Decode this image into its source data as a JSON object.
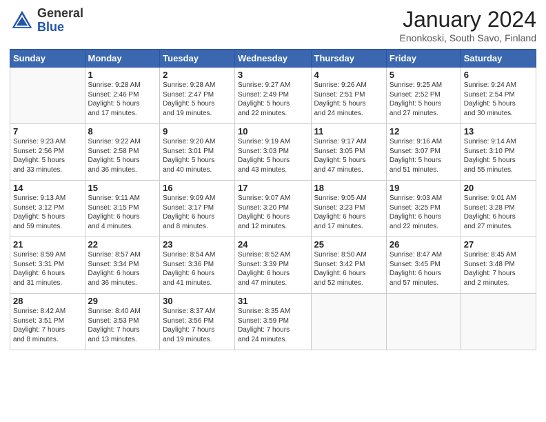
{
  "logo": {
    "general": "General",
    "blue": "Blue"
  },
  "header": {
    "month": "January 2024",
    "location": "Enonkoski, South Savo, Finland"
  },
  "weekdays": [
    "Sunday",
    "Monday",
    "Tuesday",
    "Wednesday",
    "Thursday",
    "Friday",
    "Saturday"
  ],
  "weeks": [
    [
      {
        "day": "",
        "info": ""
      },
      {
        "day": "1",
        "info": "Sunrise: 9:28 AM\nSunset: 2:46 PM\nDaylight: 5 hours\nand 17 minutes."
      },
      {
        "day": "2",
        "info": "Sunrise: 9:28 AM\nSunset: 2:47 PM\nDaylight: 5 hours\nand 19 minutes."
      },
      {
        "day": "3",
        "info": "Sunrise: 9:27 AM\nSunset: 2:49 PM\nDaylight: 5 hours\nand 22 minutes."
      },
      {
        "day": "4",
        "info": "Sunrise: 9:26 AM\nSunset: 2:51 PM\nDaylight: 5 hours\nand 24 minutes."
      },
      {
        "day": "5",
        "info": "Sunrise: 9:25 AM\nSunset: 2:52 PM\nDaylight: 5 hours\nand 27 minutes."
      },
      {
        "day": "6",
        "info": "Sunrise: 9:24 AM\nSunset: 2:54 PM\nDaylight: 5 hours\nand 30 minutes."
      }
    ],
    [
      {
        "day": "7",
        "info": "Sunrise: 9:23 AM\nSunset: 2:56 PM\nDaylight: 5 hours\nand 33 minutes."
      },
      {
        "day": "8",
        "info": "Sunrise: 9:22 AM\nSunset: 2:58 PM\nDaylight: 5 hours\nand 36 minutes."
      },
      {
        "day": "9",
        "info": "Sunrise: 9:20 AM\nSunset: 3:01 PM\nDaylight: 5 hours\nand 40 minutes."
      },
      {
        "day": "10",
        "info": "Sunrise: 9:19 AM\nSunset: 3:03 PM\nDaylight: 5 hours\nand 43 minutes."
      },
      {
        "day": "11",
        "info": "Sunrise: 9:17 AM\nSunset: 3:05 PM\nDaylight: 5 hours\nand 47 minutes."
      },
      {
        "day": "12",
        "info": "Sunrise: 9:16 AM\nSunset: 3:07 PM\nDaylight: 5 hours\nand 51 minutes."
      },
      {
        "day": "13",
        "info": "Sunrise: 9:14 AM\nSunset: 3:10 PM\nDaylight: 5 hours\nand 55 minutes."
      }
    ],
    [
      {
        "day": "14",
        "info": "Sunrise: 9:13 AM\nSunset: 3:12 PM\nDaylight: 5 hours\nand 59 minutes."
      },
      {
        "day": "15",
        "info": "Sunrise: 9:11 AM\nSunset: 3:15 PM\nDaylight: 6 hours\nand 4 minutes."
      },
      {
        "day": "16",
        "info": "Sunrise: 9:09 AM\nSunset: 3:17 PM\nDaylight: 6 hours\nand 8 minutes."
      },
      {
        "day": "17",
        "info": "Sunrise: 9:07 AM\nSunset: 3:20 PM\nDaylight: 6 hours\nand 12 minutes."
      },
      {
        "day": "18",
        "info": "Sunrise: 9:05 AM\nSunset: 3:23 PM\nDaylight: 6 hours\nand 17 minutes."
      },
      {
        "day": "19",
        "info": "Sunrise: 9:03 AM\nSunset: 3:25 PM\nDaylight: 6 hours\nand 22 minutes."
      },
      {
        "day": "20",
        "info": "Sunrise: 9:01 AM\nSunset: 3:28 PM\nDaylight: 6 hours\nand 27 minutes."
      }
    ],
    [
      {
        "day": "21",
        "info": "Sunrise: 8:59 AM\nSunset: 3:31 PM\nDaylight: 6 hours\nand 31 minutes."
      },
      {
        "day": "22",
        "info": "Sunrise: 8:57 AM\nSunset: 3:34 PM\nDaylight: 6 hours\nand 36 minutes."
      },
      {
        "day": "23",
        "info": "Sunrise: 8:54 AM\nSunset: 3:36 PM\nDaylight: 6 hours\nand 41 minutes."
      },
      {
        "day": "24",
        "info": "Sunrise: 8:52 AM\nSunset: 3:39 PM\nDaylight: 6 hours\nand 47 minutes."
      },
      {
        "day": "25",
        "info": "Sunrise: 8:50 AM\nSunset: 3:42 PM\nDaylight: 6 hours\nand 52 minutes."
      },
      {
        "day": "26",
        "info": "Sunrise: 8:47 AM\nSunset: 3:45 PM\nDaylight: 6 hours\nand 57 minutes."
      },
      {
        "day": "27",
        "info": "Sunrise: 8:45 AM\nSunset: 3:48 PM\nDaylight: 7 hours\nand 2 minutes."
      }
    ],
    [
      {
        "day": "28",
        "info": "Sunrise: 8:42 AM\nSunset: 3:51 PM\nDaylight: 7 hours\nand 8 minutes."
      },
      {
        "day": "29",
        "info": "Sunrise: 8:40 AM\nSunset: 3:53 PM\nDaylight: 7 hours\nand 13 minutes."
      },
      {
        "day": "30",
        "info": "Sunrise: 8:37 AM\nSunset: 3:56 PM\nDaylight: 7 hours\nand 19 minutes."
      },
      {
        "day": "31",
        "info": "Sunrise: 8:35 AM\nSunset: 3:59 PM\nDaylight: 7 hours\nand 24 minutes."
      },
      {
        "day": "",
        "info": ""
      },
      {
        "day": "",
        "info": ""
      },
      {
        "day": "",
        "info": ""
      }
    ]
  ]
}
